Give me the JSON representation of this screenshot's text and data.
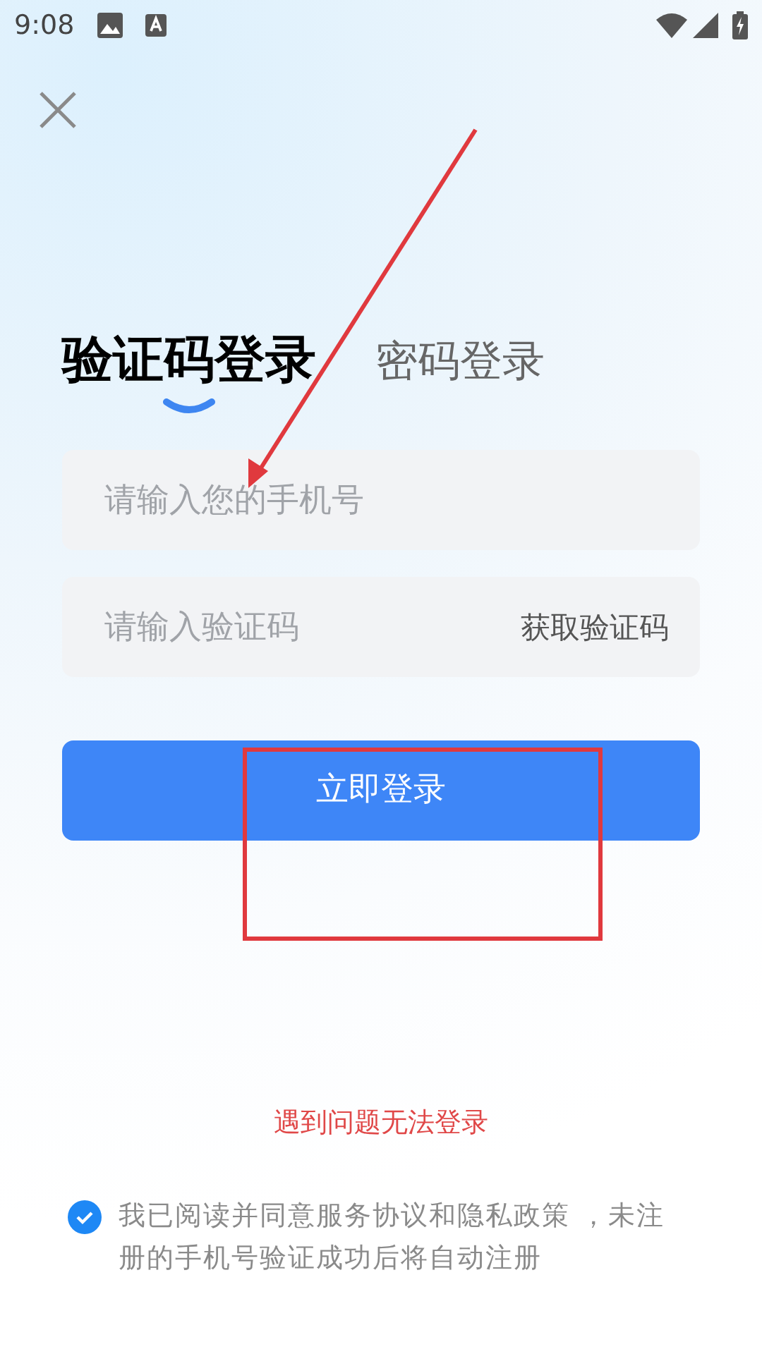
{
  "status_bar": {
    "time": "9:08"
  },
  "tabs": [
    {
      "label": "验证码登录",
      "selected": true
    },
    {
      "label": "密码登录",
      "selected": false
    }
  ],
  "fields": [
    {
      "placeholder": "请输入您的手机号"
    },
    {
      "placeholder": "请输入验证码",
      "action": "获取验证码"
    }
  ],
  "login_button": "立即登录",
  "help_link": "遇到问题无法登录",
  "agreement": {
    "checked": true,
    "text": "我已阅读并同意服务协议和隐私政策 ，未注册的手机号验证成功后将自动注册"
  }
}
